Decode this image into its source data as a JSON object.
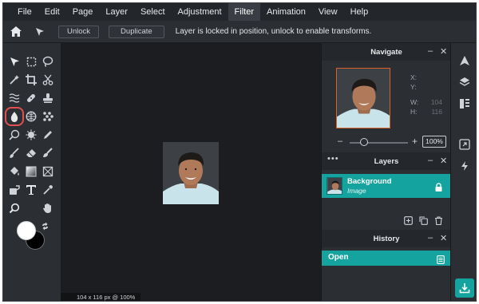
{
  "menubar": {
    "items": [
      "File",
      "Edit",
      "Page",
      "Layer",
      "Select",
      "Adjustment",
      "Filter",
      "Animation",
      "View",
      "Help"
    ],
    "active_item": "Filter"
  },
  "toolbar": {
    "unlock_label": "Unlock",
    "duplicate_label": "Duplicate",
    "message": "Layer is locked in position, unlock to enable transforms."
  },
  "tools": {
    "icons": [
      "pointer-icon",
      "marquee-icon",
      "lasso-icon",
      "magic-wand-icon",
      "crop-icon",
      "scissors-icon",
      "liquify-icon",
      "heal-icon",
      "stamp-icon",
      "blur-icon",
      "sponge-icon",
      "pattern-icon",
      "dodge-icon",
      "burn-icon",
      "pencil-icon",
      "brush-icon",
      "eraser-icon",
      "smudge-icon",
      "fill-icon",
      "gradient-icon",
      "shape-icon",
      "paint-icon",
      "text-icon",
      "eyedropper-icon",
      "zoom-icon",
      "hand-icon"
    ],
    "selected_tool": "blur-icon",
    "foreground_color": "#ffffff",
    "background_color": "#000000"
  },
  "canvas": {
    "status": "104 x 116 px @ 100%"
  },
  "navigate": {
    "title": "Navigate",
    "x_label": "X:",
    "y_label": "Y:",
    "w_label": "W:",
    "w_value": "104",
    "h_label": "H:",
    "h_value": "116",
    "zoom": "100%"
  },
  "layers": {
    "title": "Layers",
    "items": [
      {
        "name": "Background",
        "type": "Image",
        "locked": true
      }
    ]
  },
  "history": {
    "title": "History",
    "items": [
      "Open"
    ]
  },
  "colors": {
    "accent": "#14a39e",
    "highlight": "#e05050",
    "panel_bg": "#2b2e33",
    "canvas_bg": "#1b1d20"
  }
}
